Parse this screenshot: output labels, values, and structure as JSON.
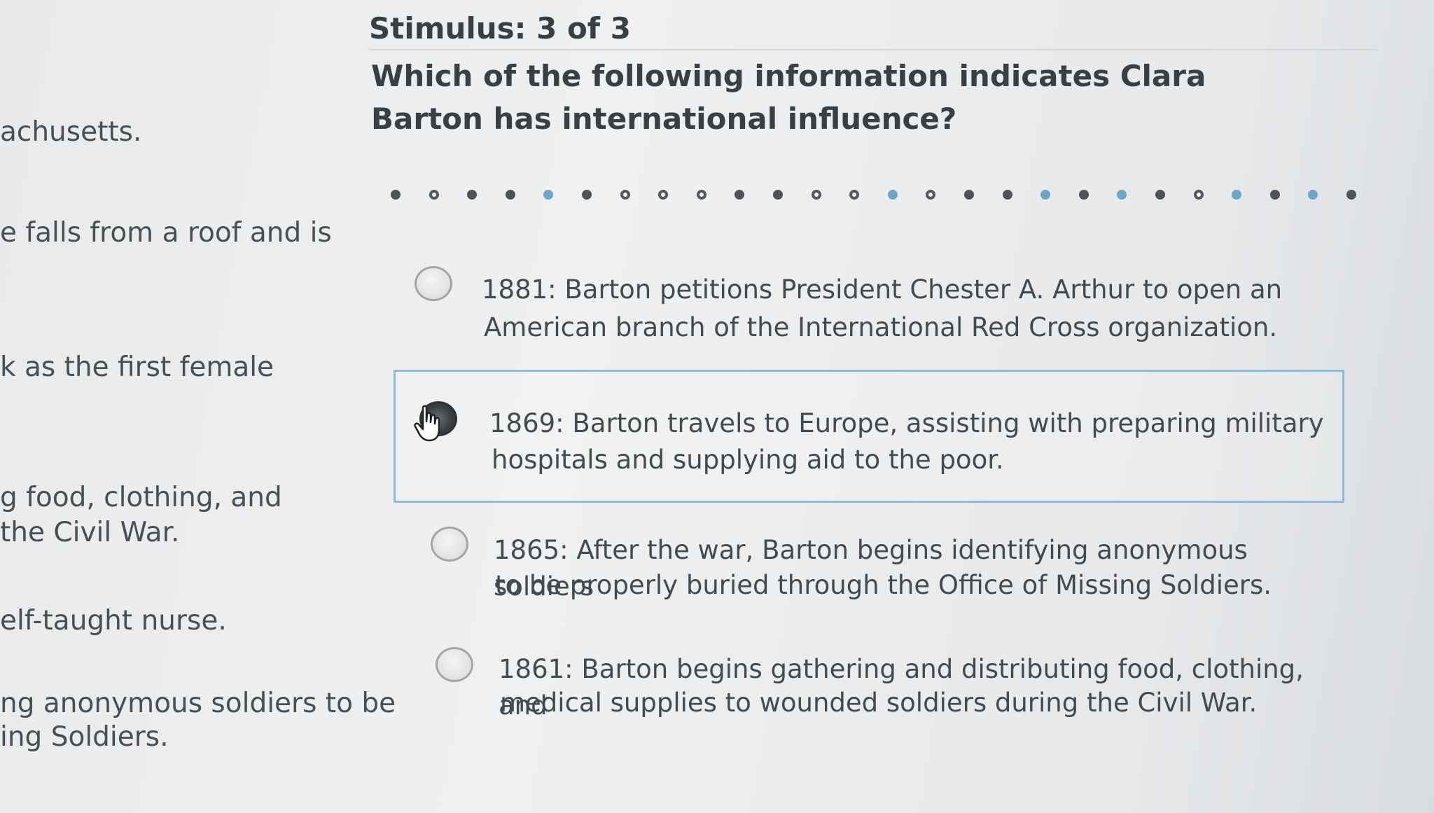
{
  "passage": {
    "lines": [
      "achusetts.",
      "e falls from a roof and is",
      "k as the first female",
      "g food, clothing, and",
      " the Civil War.",
      "elf-taught nurse.",
      "ng anonymous soldiers to be",
      "ing Soldiers."
    ]
  },
  "stimulus": {
    "header": "Stimulus: 3 of 3"
  },
  "question": {
    "text": "Which of the following information indicates Clara Barton has international influence?"
  },
  "progress_dots": [
    "filled",
    "ring",
    "filled",
    "filled",
    "blue",
    "filled",
    "ring",
    "ring",
    "ring",
    "filled",
    "filled",
    "ring",
    "ring",
    "blue",
    "ring",
    "filled",
    "filled",
    "blue",
    "filled",
    "blue",
    "filled",
    "ring",
    "blue",
    "filled",
    "blue",
    "filled"
  ],
  "choices": [
    {
      "line1": "1881: Barton petitions President Chester A. Arthur to open an",
      "line2": "American branch of the International Red Cross organization.",
      "selected": false
    },
    {
      "line1": "1869: Barton travels to Europe, assisting with preparing military",
      "line2": "hospitals and supplying aid to the poor.",
      "selected": true
    },
    {
      "line1": "1865: After the war, Barton begins identifying anonymous soldiers",
      "line2": "to be properly buried through the Office of Missing Soldiers.",
      "selected": false
    },
    {
      "line1": "1861: Barton begins gathering and distributing food, clothing, and",
      "line2": "medical supplies to wounded soldiers during the Civil War.",
      "selected": false
    }
  ],
  "colors": {
    "selected_border": "#8fb9dd",
    "dot_blue": "#6ea6c7",
    "dot_dark": "#4f5256"
  }
}
